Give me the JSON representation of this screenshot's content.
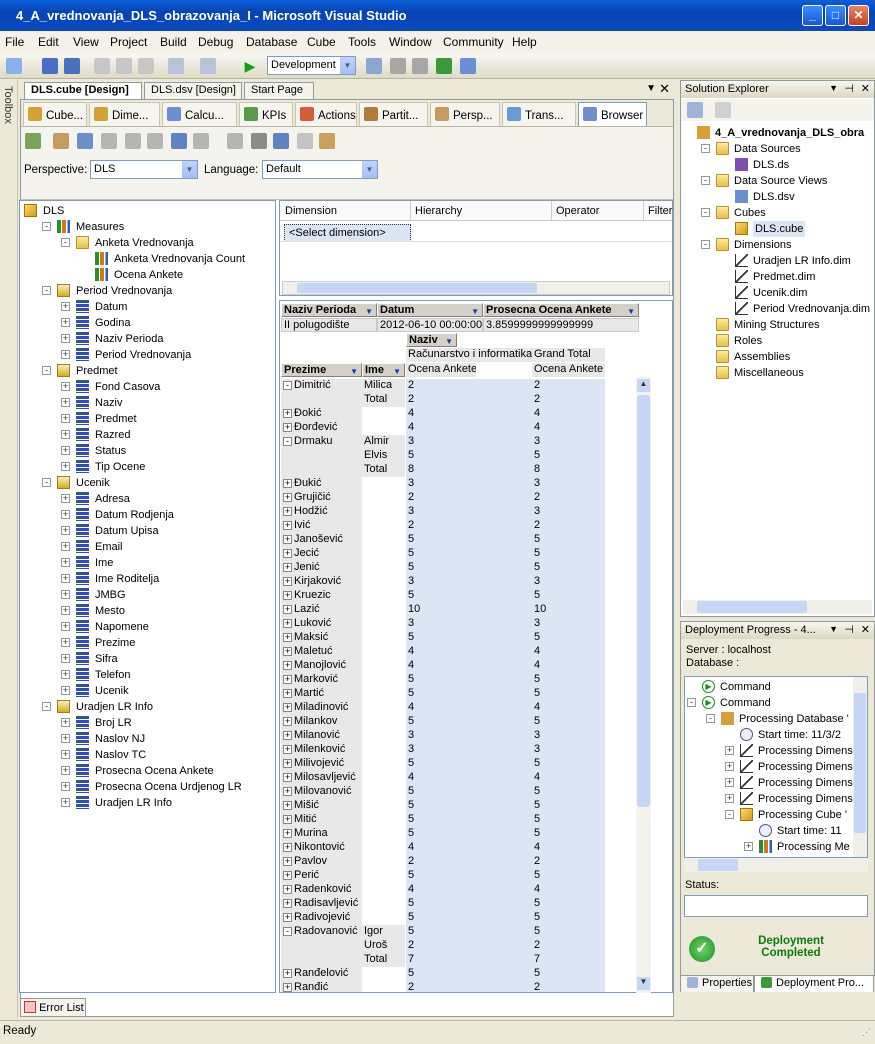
{
  "app": {
    "title": "4_A_vrednovanja_DLS_obrazovanja_I - Microsoft Visual Studio",
    "status": "Ready",
    "toolbox": "Toolbox"
  },
  "menu": [
    "File",
    "Edit",
    "View",
    "Project",
    "Build",
    "Debug",
    "Database",
    "Cube",
    "Tools",
    "Window",
    "Community",
    "Help"
  ],
  "toolbar": {
    "config": "Development"
  },
  "doc_tabs": [
    "DLS.cube [Design]",
    "DLS.dsv [Design]",
    "Start Page"
  ],
  "designer_tabs": [
    "Cube...",
    "Dime...",
    "Calcu...",
    "KPIs",
    "Actions",
    "Partit...",
    "Persp...",
    "Trans...",
    "Browser"
  ],
  "perspective": {
    "label": "Perspective:",
    "value": "DLS",
    "lang_label": "Language:",
    "lang_value": "Default"
  },
  "meta_tree": [
    {
      "t": "DLS",
      "lv": 0,
      "k": "cube"
    },
    {
      "t": "Measures",
      "lv": 1,
      "k": "meas",
      "pm": "-"
    },
    {
      "t": "Anketa Vrednovanja",
      "lv": 2,
      "k": "folder",
      "pm": "-"
    },
    {
      "t": "Anketa Vrednovanja Count",
      "lv": 3,
      "k": "meas"
    },
    {
      "t": "Ocena Ankete",
      "lv": 3,
      "k": "meas"
    },
    {
      "t": "Period Vrednovanja",
      "lv": 1,
      "k": "dim",
      "pm": "-"
    },
    {
      "t": "Datum",
      "lv": 2,
      "k": "hier",
      "pm": "+"
    },
    {
      "t": "Godina",
      "lv": 2,
      "k": "hier",
      "pm": "+"
    },
    {
      "t": "Naziv Perioda",
      "lv": 2,
      "k": "hier",
      "pm": "+"
    },
    {
      "t": "Period Vrednovanja",
      "lv": 2,
      "k": "hier",
      "pm": "+"
    },
    {
      "t": "Predmet",
      "lv": 1,
      "k": "dim",
      "pm": "-"
    },
    {
      "t": "Fond Casova",
      "lv": 2,
      "k": "hier",
      "pm": "+"
    },
    {
      "t": "Naziv",
      "lv": 2,
      "k": "hier",
      "pm": "+"
    },
    {
      "t": "Predmet",
      "lv": 2,
      "k": "hier",
      "pm": "+"
    },
    {
      "t": "Razred",
      "lv": 2,
      "k": "hier",
      "pm": "+"
    },
    {
      "t": "Status",
      "lv": 2,
      "k": "hier",
      "pm": "+"
    },
    {
      "t": "Tip Ocene",
      "lv": 2,
      "k": "hier",
      "pm": "+"
    },
    {
      "t": "Ucenik",
      "lv": 1,
      "k": "dim",
      "pm": "-"
    },
    {
      "t": "Adresa",
      "lv": 2,
      "k": "hier",
      "pm": "+"
    },
    {
      "t": "Datum Rodjenja",
      "lv": 2,
      "k": "hier",
      "pm": "+"
    },
    {
      "t": "Datum Upisa",
      "lv": 2,
      "k": "hier",
      "pm": "+"
    },
    {
      "t": "Email",
      "lv": 2,
      "k": "hier",
      "pm": "+"
    },
    {
      "t": "Ime",
      "lv": 2,
      "k": "hier",
      "pm": "+"
    },
    {
      "t": "Ime Roditelja",
      "lv": 2,
      "k": "hier",
      "pm": "+"
    },
    {
      "t": "JMBG",
      "lv": 2,
      "k": "hier",
      "pm": "+"
    },
    {
      "t": "Mesto",
      "lv": 2,
      "k": "hier",
      "pm": "+"
    },
    {
      "t": "Napomene",
      "lv": 2,
      "k": "hier",
      "pm": "+"
    },
    {
      "t": "Prezime",
      "lv": 2,
      "k": "hier",
      "pm": "+"
    },
    {
      "t": "Sifra",
      "lv": 2,
      "k": "hier",
      "pm": "+"
    },
    {
      "t": "Telefon",
      "lv": 2,
      "k": "hier",
      "pm": "+"
    },
    {
      "t": "Ucenik",
      "lv": 2,
      "k": "hier",
      "pm": "+"
    },
    {
      "t": "Uradjen LR Info",
      "lv": 1,
      "k": "dim",
      "pm": "-"
    },
    {
      "t": "Broj LR",
      "lv": 2,
      "k": "hier",
      "pm": "+"
    },
    {
      "t": "Naslov NJ",
      "lv": 2,
      "k": "hier",
      "pm": "+"
    },
    {
      "t": "Naslov TC",
      "lv": 2,
      "k": "hier",
      "pm": "+"
    },
    {
      "t": "Prosecna Ocena Ankete",
      "lv": 2,
      "k": "hier",
      "pm": "+"
    },
    {
      "t": "Prosecna Ocena Urdjenog LR",
      "lv": 2,
      "k": "hier",
      "pm": "+"
    },
    {
      "t": "Uradjen LR Info",
      "lv": 2,
      "k": "hier",
      "pm": "+"
    }
  ],
  "filter": {
    "cols": [
      "Dimension",
      "Hierarchy",
      "Operator",
      "Filter"
    ],
    "select": "<Select dimension>"
  },
  "pivot": {
    "filter_headers": [
      "Naziv Perioda",
      "Datum",
      "Prosecna Ocena Ankete"
    ],
    "filter_values": [
      "II polugodište",
      "2012-06-10 00:00:00",
      "3.8599999999999999"
    ],
    "col_field": "Naziv",
    "col_members": [
      "Računarstvo i informatika",
      "Grand Total"
    ],
    "measure": "Ocena Ankete",
    "row_fields": [
      "Prezime",
      "Ime"
    ],
    "rows": [
      {
        "p": "Dimitrić",
        "e": "-",
        "i": "Milica",
        "a": "2",
        "b": "2"
      },
      {
        "p": "",
        "i": "Total",
        "a": "2",
        "b": "2"
      },
      {
        "p": "Đokić",
        "e": "+",
        "i": "",
        "a": "4",
        "b": "4"
      },
      {
        "p": "Đorđević",
        "e": "+",
        "i": "",
        "a": "4",
        "b": "4"
      },
      {
        "p": "Drmaku",
        "e": "-",
        "i": "Almir",
        "a": "3",
        "b": "3"
      },
      {
        "p": "",
        "i": "Elvis",
        "a": "5",
        "b": "5"
      },
      {
        "p": "",
        "i": "Total",
        "a": "8",
        "b": "8"
      },
      {
        "p": "Đukić",
        "e": "+",
        "i": "",
        "a": "3",
        "b": "3"
      },
      {
        "p": "Grujičić",
        "e": "+",
        "i": "",
        "a": "2",
        "b": "2"
      },
      {
        "p": "Hodžić",
        "e": "+",
        "i": "",
        "a": "3",
        "b": "3"
      },
      {
        "p": "Ivić",
        "e": "+",
        "i": "",
        "a": "2",
        "b": "2"
      },
      {
        "p": "Janošević",
        "e": "+",
        "i": "",
        "a": "5",
        "b": "5"
      },
      {
        "p": "Jecić",
        "e": "+",
        "i": "",
        "a": "5",
        "b": "5"
      },
      {
        "p": "Jenić",
        "e": "+",
        "i": "",
        "a": "5",
        "b": "5"
      },
      {
        "p": "Kirjaković",
        "e": "+",
        "i": "",
        "a": "3",
        "b": "3"
      },
      {
        "p": "Kruezic",
        "e": "+",
        "i": "",
        "a": "5",
        "b": "5"
      },
      {
        "p": "Lazić",
        "e": "+",
        "i": "",
        "a": "10",
        "b": "10"
      },
      {
        "p": "Luković",
        "e": "+",
        "i": "",
        "a": "3",
        "b": "3"
      },
      {
        "p": "Maksić",
        "e": "+",
        "i": "",
        "a": "5",
        "b": "5"
      },
      {
        "p": "Maletuć",
        "e": "+",
        "i": "",
        "a": "4",
        "b": "4"
      },
      {
        "p": "Manojlović",
        "e": "+",
        "i": "",
        "a": "4",
        "b": "4"
      },
      {
        "p": "Marković",
        "e": "+",
        "i": "",
        "a": "5",
        "b": "5"
      },
      {
        "p": "Martić",
        "e": "+",
        "i": "",
        "a": "5",
        "b": "5"
      },
      {
        "p": "Miladinović",
        "e": "+",
        "i": "",
        "a": "4",
        "b": "4"
      },
      {
        "p": "Milankov",
        "e": "+",
        "i": "",
        "a": "5",
        "b": "5"
      },
      {
        "p": "Milanović",
        "e": "+",
        "i": "",
        "a": "3",
        "b": "3"
      },
      {
        "p": "Milenković",
        "e": "+",
        "i": "",
        "a": "3",
        "b": "3"
      },
      {
        "p": "Milivojević",
        "e": "+",
        "i": "",
        "a": "5",
        "b": "5"
      },
      {
        "p": "Milosavljević",
        "e": "+",
        "i": "",
        "a": "4",
        "b": "4"
      },
      {
        "p": "Milovanović",
        "e": "+",
        "i": "",
        "a": "5",
        "b": "5"
      },
      {
        "p": "Mišić",
        "e": "+",
        "i": "",
        "a": "5",
        "b": "5"
      },
      {
        "p": "Mitić",
        "e": "+",
        "i": "",
        "a": "5",
        "b": "5"
      },
      {
        "p": "Murina",
        "e": "+",
        "i": "",
        "a": "5",
        "b": "5"
      },
      {
        "p": "Nikontović",
        "e": "+",
        "i": "",
        "a": "4",
        "b": "4"
      },
      {
        "p": "Pavlov",
        "e": "+",
        "i": "",
        "a": "2",
        "b": "2"
      },
      {
        "p": "Perić",
        "e": "+",
        "i": "",
        "a": "5",
        "b": "5"
      },
      {
        "p": "Radenković",
        "e": "+",
        "i": "",
        "a": "4",
        "b": "4"
      },
      {
        "p": "Radisavljević",
        "e": "+",
        "i": "",
        "a": "5",
        "b": "5"
      },
      {
        "p": "Radivojević",
        "e": "+",
        "i": "",
        "a": "5",
        "b": "5"
      },
      {
        "p": "Radovanović",
        "e": "-",
        "i": "Igor",
        "a": "5",
        "b": "5"
      },
      {
        "p": "",
        "i": "Uroš",
        "a": "2",
        "b": "2"
      },
      {
        "p": "",
        "i": "Total",
        "a": "7",
        "b": "7"
      },
      {
        "p": "Ranđelović",
        "e": "+",
        "i": "",
        "a": "5",
        "b": "5"
      },
      {
        "p": "Ranđić",
        "e": "+",
        "i": "",
        "a": "2",
        "b": "2"
      }
    ]
  },
  "solution": {
    "title": "Solution Explorer",
    "tree": [
      {
        "t": "4_A_vrednovanja_DLS_obra",
        "lv": 0,
        "k": "proj",
        "b": true
      },
      {
        "t": "Data Sources",
        "lv": 1,
        "k": "folder",
        "pm": "-"
      },
      {
        "t": "DLS.ds",
        "lv": 2,
        "k": "ds"
      },
      {
        "t": "Data Source Views",
        "lv": 1,
        "k": "folder",
        "pm": "-"
      },
      {
        "t": "DLS.dsv",
        "lv": 2,
        "k": "dsv"
      },
      {
        "t": "Cubes",
        "lv": 1,
        "k": "folder",
        "pm": "-"
      },
      {
        "t": "DLS.cube",
        "lv": 2,
        "k": "cube",
        "sel": true
      },
      {
        "t": "Dimensions",
        "lv": 1,
        "k": "folder",
        "pm": "-"
      },
      {
        "t": "Uradjen LR Info.dim",
        "lv": 2,
        "k": "dimf"
      },
      {
        "t": "Predmet.dim",
        "lv": 2,
        "k": "dimf"
      },
      {
        "t": "Ucenik.dim",
        "lv": 2,
        "k": "dimf"
      },
      {
        "t": "Period Vrednovanja.dim",
        "lv": 2,
        "k": "dimf"
      },
      {
        "t": "Mining Structures",
        "lv": 1,
        "k": "folder"
      },
      {
        "t": "Roles",
        "lv": 1,
        "k": "folder"
      },
      {
        "t": "Assemblies",
        "lv": 1,
        "k": "folder"
      },
      {
        "t": "Miscellaneous",
        "lv": 1,
        "k": "folder"
      }
    ]
  },
  "deploy": {
    "title": "Deployment Progress - 4...",
    "server": "Server :  localhost",
    "database": "Database :",
    "tree": [
      {
        "t": "Command",
        "lv": 1,
        "k": "run"
      },
      {
        "t": "Command",
        "lv": 1,
        "k": "run",
        "pm": "-"
      },
      {
        "t": "Processing Database '",
        "lv": 2,
        "k": "db",
        "pm": "-"
      },
      {
        "t": "Start time: 11/3/2",
        "lv": 3,
        "k": "clock"
      },
      {
        "t": "Processing Dimens",
        "lv": 3,
        "k": "dimf",
        "pm": "+"
      },
      {
        "t": "Processing Dimens",
        "lv": 3,
        "k": "dimf",
        "pm": "+"
      },
      {
        "t": "Processing Dimens",
        "lv": 3,
        "k": "dimf",
        "pm": "+"
      },
      {
        "t": "Processing Dimens",
        "lv": 3,
        "k": "dimf",
        "pm": "+"
      },
      {
        "t": "Processing Cube '",
        "lv": 3,
        "k": "cube",
        "pm": "-"
      },
      {
        "t": "Start time: 11",
        "lv": 4,
        "k": "clock"
      },
      {
        "t": "Processing Me",
        "lv": 4,
        "k": "meas",
        "pm": "+"
      }
    ],
    "status_label": "Status:",
    "result": "Deployment Completed"
  },
  "bottom_tabs": [
    "Properties",
    "Deployment Pro..."
  ],
  "error_list": "Error List"
}
